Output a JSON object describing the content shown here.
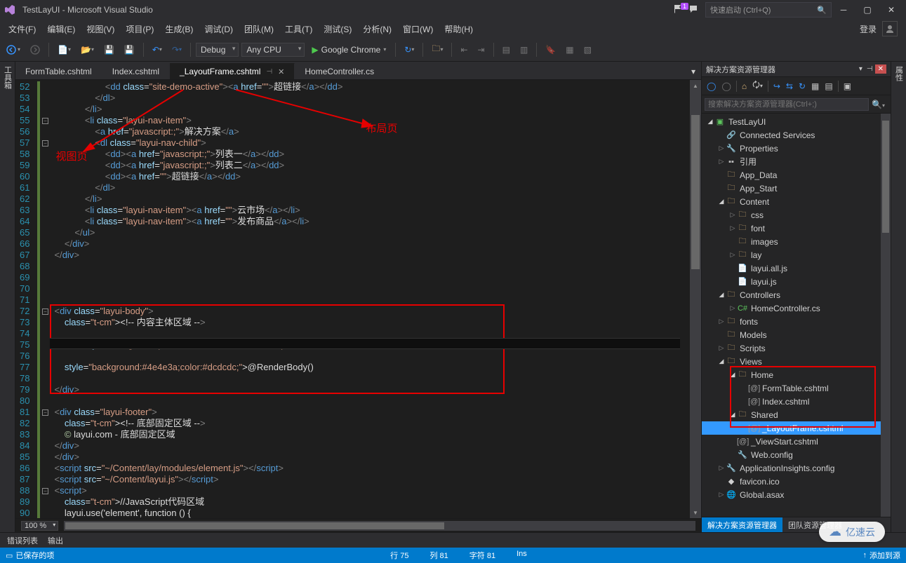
{
  "title": {
    "app": "TestLayUI - Microsoft Visual Studio"
  },
  "quick_launch": {
    "placeholder": "快速启动 (Ctrl+Q)"
  },
  "badge": {
    "notif": "1"
  },
  "menu": {
    "file": "文件(F)",
    "edit": "编辑(E)",
    "view": "视图(V)",
    "project": "项目(P)",
    "build": "生成(B)",
    "debug": "调试(D)",
    "team": "团队(M)",
    "tools": "工具(T)",
    "test": "测试(S)",
    "analyze": "分析(N)",
    "window": "窗口(W)",
    "help": "帮助(H)",
    "login": "登录"
  },
  "toolbar": {
    "config": "Debug",
    "platform": "Any CPU",
    "browser": "Google Chrome"
  },
  "tabs": {
    "t0": "FormTable.cshtml",
    "t1": "Index.cshtml",
    "t2": "_LayoutFrame.cshtml",
    "t3": "HomeController.cs"
  },
  "left_tool": "工具箱",
  "right_tool": "属性",
  "solution": {
    "panel_title": "解决方案资源管理器",
    "search_placeholder": "搜索解决方案资源管理器(Ctrl+;)",
    "tab_active": "解决方案资源管理器",
    "tab_other": "团队资源管理器",
    "tree": {
      "proj": "TestLayUI",
      "connected": "Connected Services",
      "props": "Properties",
      "refs": "引用",
      "appdata": "App_Data",
      "appstart": "App_Start",
      "content": "Content",
      "css": "css",
      "font": "font",
      "images": "images",
      "lay": "lay",
      "layuiall": "layui.all.js",
      "layuijs": "layui.js",
      "controllers": "Controllers",
      "homectrl": "HomeController.cs",
      "fonts": "fonts",
      "models": "Models",
      "scripts": "Scripts",
      "views": "Views",
      "home": "Home",
      "formtable": "FormTable.cshtml",
      "indexcs": "Index.cshtml",
      "shared": "Shared",
      "layoutframe": "_LayoutFrame.cshtml",
      "viewstart": "_ViewStart.cshtml",
      "webconfig": "Web.config",
      "appins": "ApplicationInsights.config",
      "favicon": "favicon.ico",
      "global": "Global.asax"
    }
  },
  "code": {
    "lines_start": 52,
    "lines": [
      "                    <dd class=\"site-demo-active\"><a href=\"\">超链接</a></dd>",
      "                </dl>",
      "            </li>",
      "            <li class=\"layui-nav-item\">",
      "                <a href=\"javascript:;\">解决方案</a>",
      "                <dl class=\"layui-nav-child\">",
      "                    <dd><a href=\"javascript:;\">列表一</a></dd>",
      "                    <dd><a href=\"javascript:;\">列表二</a></dd>",
      "                    <dd><a href=\"\">超链接</a></dd>",
      "                </dl>",
      "            </li>",
      "            <li class=\"layui-nav-item\"><a href=\"\">云市场</a></li>",
      "            <li class=\"layui-nav-item\"><a href=\"\">发布商品</a></li>",
      "        </ul>",
      "    </div>",
      "</div>",
      "",
      "",
      "",
      "",
      "<div class=\"layui-body\">",
      "    <!-- 内容主体区域 -->",
      "",
      "    <h6  style=\"margin:100px auto auto auto; font-size:20px; color:red;\">内容主体区域</h6>",
      "",
      "    @RenderBody()",
      "",
      "</div>",
      "",
      "<div class=\"layui-footer\">",
      "    <!-- 底部固定区域 -->",
      "    © layui.com - 底部固定区域",
      "</div>",
      "</div>",
      "<script src=\"~/Content/lay/modules/element.js\"></script>",
      "<script src=\"~/Content/layui.js\"></script>",
      "<script>",
      "    //JavaScript代码区域",
      "    layui.use('element', function () {"
    ]
  },
  "annotations": {
    "view_page": "视图页",
    "layout_page": "布局页"
  },
  "zoom": "100 %",
  "bottom": {
    "errors": "错误列表",
    "output": "输出"
  },
  "status": {
    "saved": "已保存的项",
    "line": "行 75",
    "col": "列 81",
    "char": "字符 81",
    "ins": "Ins",
    "publish": "添加到源"
  },
  "watermark": "亿速云"
}
